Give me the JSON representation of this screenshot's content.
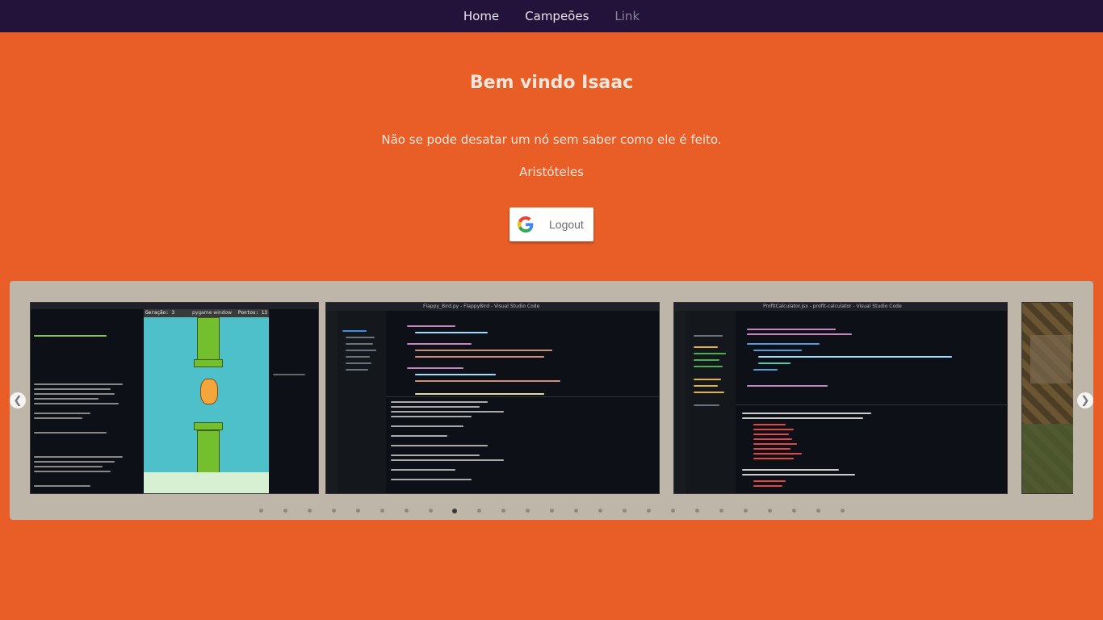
{
  "nav": {
    "items": [
      {
        "label": "Home",
        "muted": false
      },
      {
        "label": "Campeões",
        "muted": false
      },
      {
        "label": "Link",
        "muted": true
      }
    ]
  },
  "hero": {
    "welcome": "Bem vindo Isaac",
    "quote": "Não se pode desatar um nó sem saber como ele é feito.",
    "author": "Aristóteles"
  },
  "logout": {
    "label": "Logout",
    "icon": "google-icon"
  },
  "carousel": {
    "prev_icon": "chevron-left-icon",
    "next_icon": "chevron-right-icon",
    "slides": [
      {
        "name": "flappy-bird-pygame-screenshot",
        "window_title": "pygame window",
        "score_left": "Geração: 3",
        "score_right": "Pontos: 13"
      },
      {
        "name": "vscode-flappy-bird-screenshot",
        "window_title": "Flappy_Bird.py - FlappyBird - Visual Studio Code"
      },
      {
        "name": "vscode-profitcalculator-screenshot",
        "window_title": "ProfitCalculator.jsx - profit-calculator - Visual Studio Code"
      },
      {
        "name": "game-tiles-screenshot",
        "window_title": ""
      }
    ],
    "dot_count": 25,
    "active_dot": 8
  },
  "colors": {
    "nav_bg": "#23133a",
    "page_bg": "#e95e27",
    "carousel_bg": "#bdb6a9"
  }
}
